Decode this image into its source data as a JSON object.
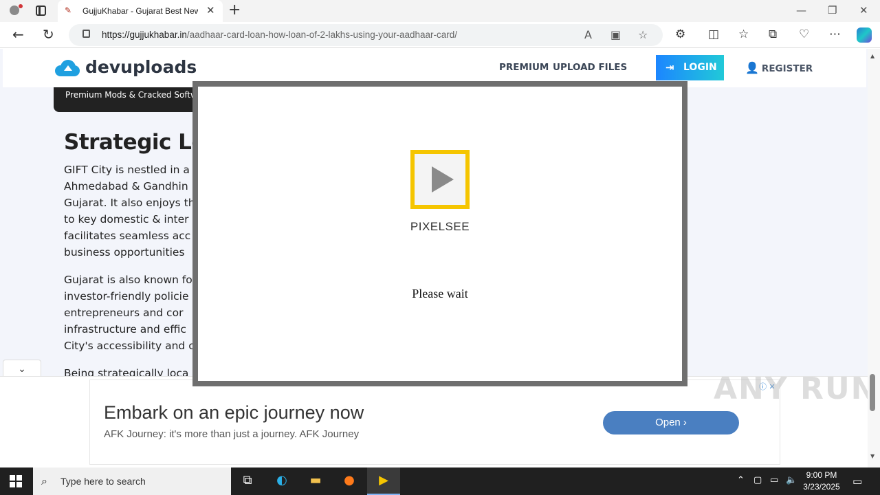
{
  "browser": {
    "tab_title": "GujjuKhabar - Gujarat Best News",
    "url_domain": "https://gujjukhabar.in",
    "url_path": "/aadhaar-card-loan-how-loan-of-2-lakhs-using-your-aadhaar-card/"
  },
  "site": {
    "logo_text": "devuploads",
    "nav_premium": "PREMIUM",
    "nav_upload": "UPLOAD FILES",
    "login_label": "LOGIN",
    "register_label": "REGISTER",
    "badge_text": "Premium Mods & Cracked Softw"
  },
  "article": {
    "heading": "Strategic Loca",
    "para1": [
      "GIFT City is nestled in a",
      "Ahmedabad & Gandhin",
      "Gujarat. It also enjoys th",
      "to key domestic & inter",
      "facilitates seamless acc",
      "business opportunities"
    ],
    "para2": [
      "Gujarat is also known fo",
      "investor-friendly policie",
      "entrepreneurs and cor",
      "infrastructure and effic",
      "City's accessibility and c"
    ],
    "para3": "Being strategically loca"
  },
  "modal": {
    "brand": "PIXELSEE",
    "status": "Please wait"
  },
  "ad": {
    "title": "Embark on an epic journey now",
    "subtitle": "AFK Journey: it's more than just a journey. AFK Journey",
    "button": "Open"
  },
  "watermark": "ANY RUN",
  "taskbar": {
    "search_placeholder": "Type here to search",
    "time": "9:00 PM",
    "date": "3/23/2025"
  },
  "colors": {
    "login_gradient_start": "#1c86ff",
    "login_gradient_end": "#21c9d8",
    "pixelsee_yellow": "#f5c500",
    "ad_button": "#4a7fc1"
  }
}
